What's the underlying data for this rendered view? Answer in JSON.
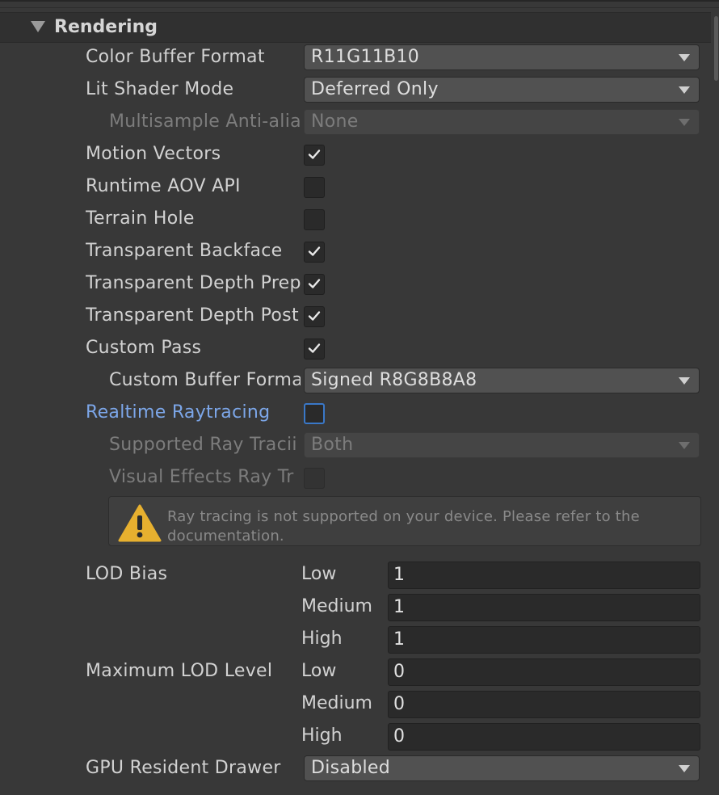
{
  "section": {
    "title": "Rendering",
    "expanded": true
  },
  "rows": {
    "color_buffer_format": {
      "label": "Color Buffer Format",
      "value": "R11G11B10"
    },
    "lit_shader_mode": {
      "label": "Lit Shader Mode",
      "value": "Deferred Only"
    },
    "msaa": {
      "label": "Multisample Anti-alia",
      "value": "None"
    },
    "motion_vectors": {
      "label": "Motion Vectors",
      "checked": true
    },
    "runtime_aov_api": {
      "label": "Runtime AOV API",
      "checked": false
    },
    "terrain_hole": {
      "label": "Terrain Hole",
      "checked": false
    },
    "transparent_backface": {
      "label": "Transparent Backface",
      "checked": true
    },
    "transparent_depth_prepass": {
      "label": "Transparent Depth Prep",
      "checked": true
    },
    "transparent_depth_postpass": {
      "label": "Transparent Depth Post",
      "checked": true
    },
    "custom_pass": {
      "label": "Custom Pass",
      "checked": true
    },
    "custom_buffer_format": {
      "label": "Custom Buffer Forma",
      "value": "Signed R8G8B8A8"
    },
    "realtime_raytracing": {
      "label": "Realtime Raytracing",
      "checked": false
    },
    "supported_ray_tracing": {
      "label": "Supported Ray Tracii",
      "value": "Both"
    },
    "vfx_ray_tracing": {
      "label": "Visual Effects Ray Tr",
      "checked": false
    }
  },
  "warning": {
    "icon": "warning-icon",
    "text": "Ray tracing is not supported on your device. Please refer to the documentation."
  },
  "lod_bias": {
    "label": "LOD Bias",
    "low_label": "Low",
    "low": "1",
    "medium_label": "Medium",
    "medium": "1",
    "high_label": "High",
    "high": "1"
  },
  "max_lod_level": {
    "label": "Maximum LOD Level",
    "low_label": "Low",
    "low": "0",
    "medium_label": "Medium",
    "medium": "0",
    "high_label": "High",
    "high": "0"
  },
  "gpu_resident_drawer": {
    "label": "GPU Resident Drawer",
    "value": "Disabled"
  },
  "colors": {
    "background": "#383838",
    "link_label": "#7ca6e8",
    "warning_yellow": "#e7b02f",
    "focus_outline": "#3a78c8"
  }
}
